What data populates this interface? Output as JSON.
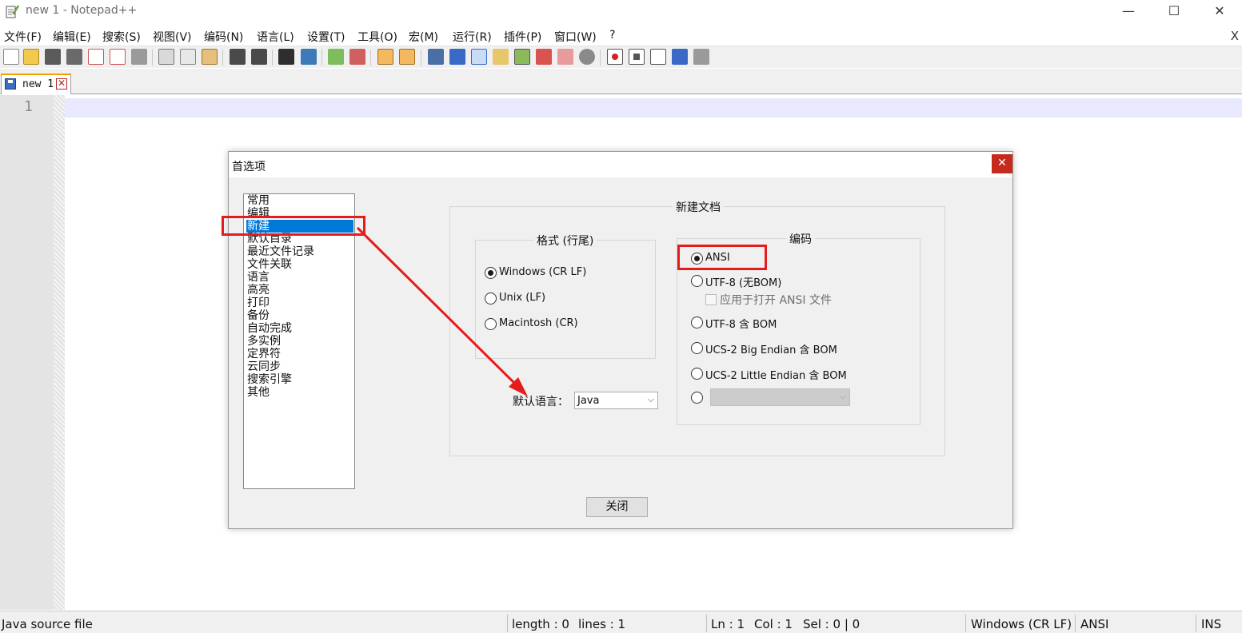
{
  "window": {
    "title": "new 1 - Notepad++",
    "minimize": "—",
    "maximize": "☐",
    "close": "✕"
  },
  "menu": {
    "items": [
      {
        "label": "文件(F)"
      },
      {
        "label": "编辑(E)"
      },
      {
        "label": "搜索(S)"
      },
      {
        "label": "视图(V)"
      },
      {
        "label": "编码(N)"
      },
      {
        "label": "语言(L)"
      },
      {
        "label": "设置(T)"
      },
      {
        "label": "工具(O)"
      },
      {
        "label": "宏(M)"
      },
      {
        "label": "运行(R)"
      },
      {
        "label": "插件(P)"
      },
      {
        "label": "窗口(W)"
      },
      {
        "label": "?"
      }
    ],
    "close_label": "X"
  },
  "toolbar": {
    "icons": [
      "new-file-icon",
      "open-file-icon",
      "save-icon",
      "save-all-icon",
      "close-file-icon",
      "close-all-icon",
      "print-icon",
      "cut-icon",
      "copy-icon",
      "paste-icon",
      "undo-icon",
      "redo-icon",
      "find-icon",
      "replace-icon",
      "zoom-in-icon",
      "zoom-out-icon",
      "sync-vertical-icon",
      "sync-horizontal-icon",
      "word-wrap-icon",
      "show-all-chars-icon",
      "indent-guide-icon",
      "user-language-icon",
      "doc-map-icon",
      "function-list-icon",
      "folder-workspace-icon",
      "monitoring-icon",
      "record-macro-icon",
      "stop-macro-icon",
      "play-macro-icon",
      "run-macro-multiple-icon",
      "save-macro-icon"
    ]
  },
  "tabs": [
    {
      "label": "new 1",
      "close": "✕"
    }
  ],
  "editor": {
    "line_numbers": [
      "1"
    ]
  },
  "statusbar": {
    "file_type": "Java source file",
    "length": "length : 0",
    "lines": "lines : 1",
    "ln": "Ln : 1",
    "col": "Col : 1",
    "sel": "Sel : 0 | 0",
    "eol": "Windows (CR LF)",
    "encoding": "ANSI",
    "mode": "INS"
  },
  "dialog": {
    "title": "首选项",
    "close_icon": "✕",
    "categories": [
      "常用",
      "编辑",
      "新建",
      "默认目录",
      "最近文件记录",
      "文件关联",
      "语言",
      "高亮",
      "打印",
      "备份",
      "自动完成",
      "多实例",
      "定界符",
      "云同步",
      "搜索引擎",
      "其他"
    ],
    "selected_category": "新建",
    "new_document_group": "新建文档",
    "format_group": {
      "title": "格式 (行尾)",
      "options": [
        {
          "label": "Windows (CR LF)",
          "checked": true
        },
        {
          "label": "Unix (LF)",
          "checked": false
        },
        {
          "label": "Macintosh (CR)",
          "checked": false
        }
      ]
    },
    "encoding_group": {
      "title": "编码",
      "options": [
        {
          "label": "ANSI",
          "checked": true
        },
        {
          "label": "UTF-8 (无BOM)",
          "checked": false
        },
        {
          "label": "UTF-8 含 BOM",
          "checked": false
        },
        {
          "label": "UCS-2 Big Endian 含 BOM",
          "checked": false
        },
        {
          "label": "UCS-2 Little Endian 含 BOM",
          "checked": false
        }
      ],
      "apply_ansi_label": "应用于打开 ANSI 文件",
      "other_select_value": ""
    },
    "default_language_label": "默认语言：",
    "default_language_value": "Java",
    "close_button": "关闭"
  }
}
